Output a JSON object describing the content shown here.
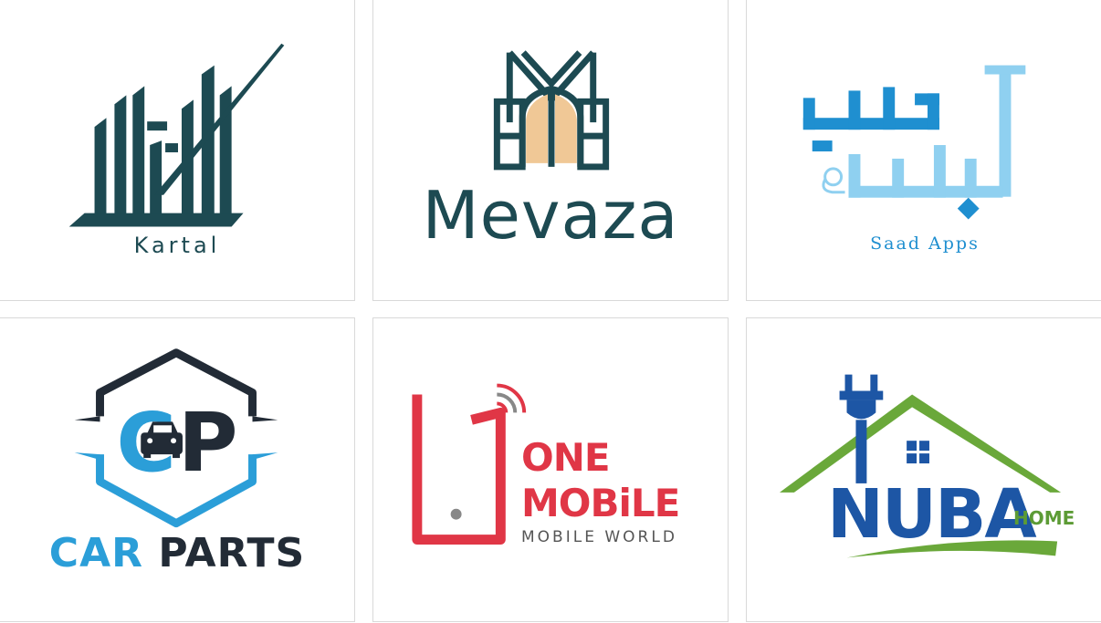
{
  "logos": [
    {
      "name": "Kartal",
      "brand_color": "#1d4a52"
    },
    {
      "name": "Mevaza",
      "brand_color": "#1d4a52",
      "accent_color": "#f0c896"
    },
    {
      "name": "Saad Apps",
      "brand_color": "#1f8fd0",
      "accent_color": "#8fd0f0"
    },
    {
      "name_part1": "CAR",
      "name_part2": "PARTS",
      "monogram_1": "C",
      "monogram_2": "P",
      "brand_color": "#2b9ed8",
      "dark_color": "#222b36"
    },
    {
      "name_line1": "ONE",
      "name_line2": "MOBiLE",
      "tagline": "MOBILE WORLD",
      "brand_color": "#e03646",
      "dark_color": "#555555"
    },
    {
      "name": "NUBA",
      "suffix": "HOME",
      "brand_color": "#1d56a5",
      "accent_color": "#6aa83a"
    }
  ]
}
